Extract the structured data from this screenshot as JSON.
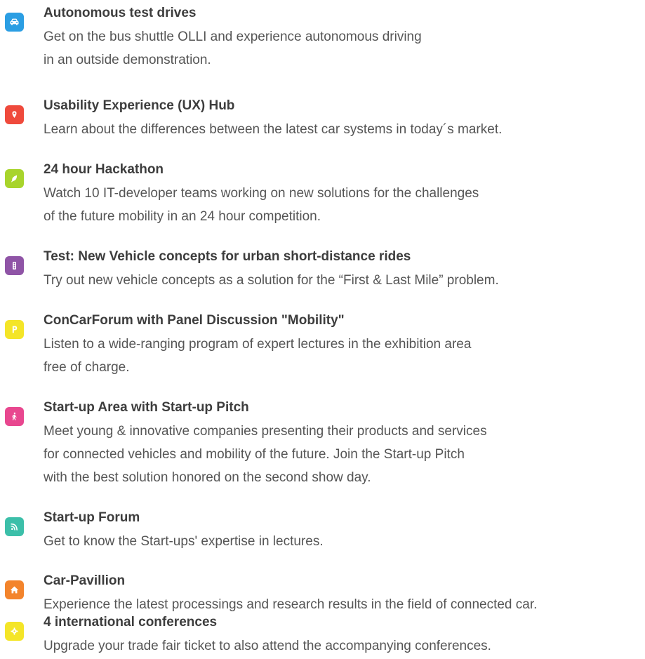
{
  "items": [
    {
      "title": "Autonomous test drives",
      "desc": [
        "Get on the bus shuttle OLLI and experience autonomous driving",
        "in an outside demonstration."
      ],
      "icon": "car-icon",
      "color": "#2b9ee3"
    },
    {
      "title": "Usability Experience (UX) Hub",
      "desc": [
        "Learn about the differences between the latest car systems in today´s market."
      ],
      "icon": "map-pin-icon",
      "color": "#ef4a3c"
    },
    {
      "title": "24 hour Hackathon",
      "desc": [
        "Watch 10 IT-developer teams working on new solutions for the challenges",
        "of the future mobility in an 24 hour competition."
      ],
      "icon": "leaf-icon",
      "color": "#a8d42c"
    },
    {
      "title": "Test: New Vehicle concepts for urban short-distance rides",
      "desc": [
        "Try out new vehicle concepts as a solution for the “First & Last Mile” problem."
      ],
      "icon": "traffic-light-icon",
      "color": "#8f54a6"
    },
    {
      "title": "ConCarForum with Panel Discussion \"Mobility\"",
      "desc": [
        "Listen to a wide-ranging program of expert lectures in the exhibition area",
        "free of charge."
      ],
      "icon": "parking-icon",
      "color": "#f4e528"
    },
    {
      "title": "Start-up Area with Start-up Pitch",
      "desc": [
        "Meet young & innovative companies presenting their products and services",
        "for connected vehicles and mobility of the future. Join the Start-up Pitch",
        "with the best solution honored on the second show day."
      ],
      "icon": "pedestrian-icon",
      "color": "#e8478f"
    },
    {
      "title": "Start-up Forum",
      "desc": [
        "Get to know the Start-ups' expertise in lectures."
      ],
      "icon": "rss-icon",
      "color": "#3cbfa9"
    },
    {
      "title": "Car-Pavillion",
      "desc": [
        "Experience the latest processings and research results in the field of connected car."
      ],
      "icon": "home-icon",
      "color": "#f3842c"
    },
    {
      "title": "4 international conferences",
      "desc": [
        "Upgrade your trade fair ticket to also attend the accompanying conferences."
      ],
      "icon": "gear-icon",
      "color": "#f4e528"
    }
  ]
}
